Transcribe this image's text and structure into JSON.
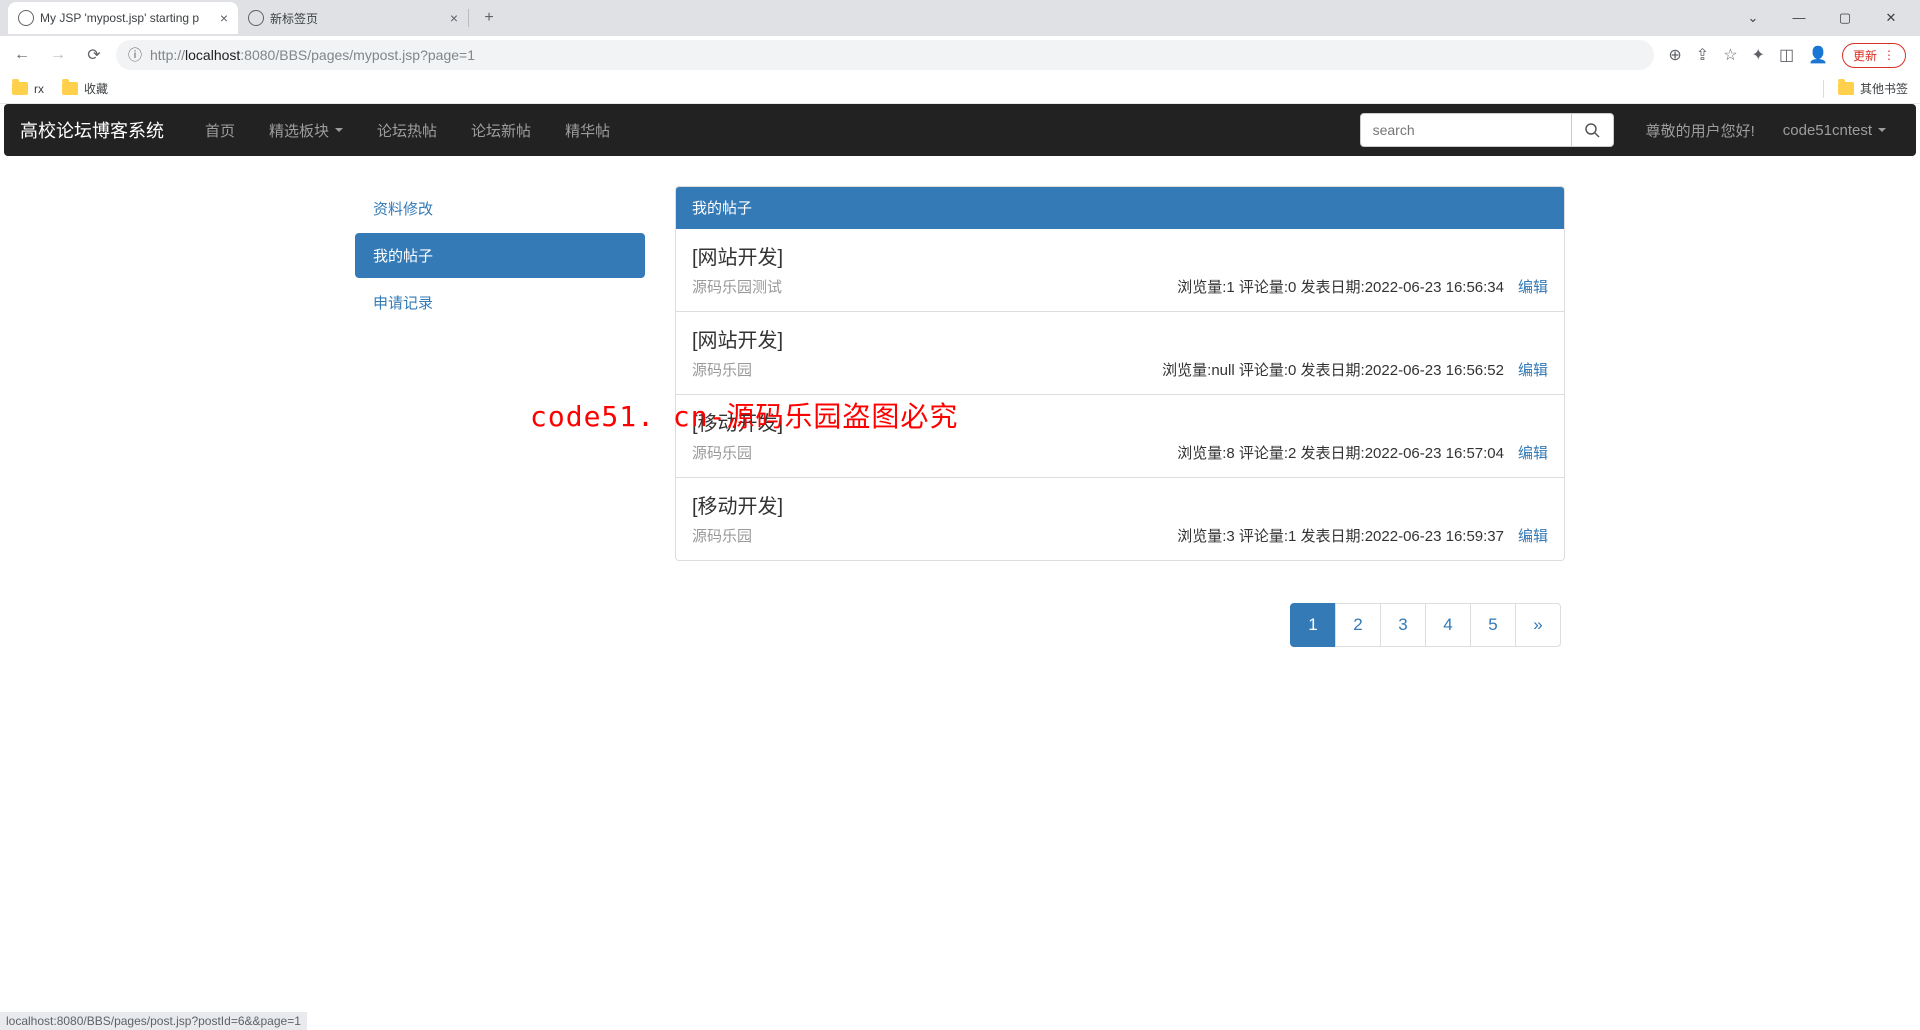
{
  "browser": {
    "tabs": [
      {
        "title": "My JSP 'mypost.jsp' starting p",
        "active": true
      },
      {
        "title": "新标签页",
        "active": false
      }
    ],
    "url_prefix": "http://",
    "url_host": "localhost",
    "url_port": ":8080",
    "url_path": "/BBS/pages/mypost.jsp?page=1",
    "update_label": "更新",
    "bookmarks": [
      {
        "label": "rx"
      },
      {
        "label": "收藏"
      }
    ],
    "other_bookmarks": "其他书签",
    "status_url": "localhost:8080/BBS/pages/post.jsp?postId=6&&page=1"
  },
  "navbar": {
    "brand": "高校论坛博客系统",
    "links": [
      "首页",
      "精选板块",
      "论坛热帖",
      "论坛新帖",
      "精华帖"
    ],
    "search_placeholder": "search",
    "greeting": "尊敬的用户您好!",
    "username": "code51cntest"
  },
  "sidebar": {
    "items": [
      {
        "label": "资料修改",
        "active": false
      },
      {
        "label": "我的帖子",
        "active": true
      },
      {
        "label": "申请记录",
        "active": false
      }
    ]
  },
  "panel": {
    "title": "我的帖子",
    "view_label": "浏览量",
    "comment_label": "评论量",
    "date_label": "发表日期",
    "edit_label": "编辑",
    "posts": [
      {
        "category": "[网站开发]",
        "subtitle": "源码乐园测试",
        "views": "1",
        "comments": "0",
        "date": "2022-06-23 16:56:34"
      },
      {
        "category": "[网站开发]",
        "subtitle": "源码乐园",
        "views": "null",
        "comments": "0",
        "date": "2022-06-23 16:56:52"
      },
      {
        "category": "[移动开发]",
        "subtitle": "源码乐园",
        "views": "8",
        "comments": "2",
        "date": "2022-06-23 16:57:04"
      },
      {
        "category": "[移动开发]",
        "subtitle": "源码乐园",
        "views": "3",
        "comments": "1",
        "date": "2022-06-23 16:59:37"
      }
    ]
  },
  "pagination": {
    "pages": [
      "1",
      "2",
      "3",
      "4",
      "5"
    ],
    "active": "1",
    "next": "»"
  },
  "watermark": "code51. cn-源码乐园盗图必究"
}
